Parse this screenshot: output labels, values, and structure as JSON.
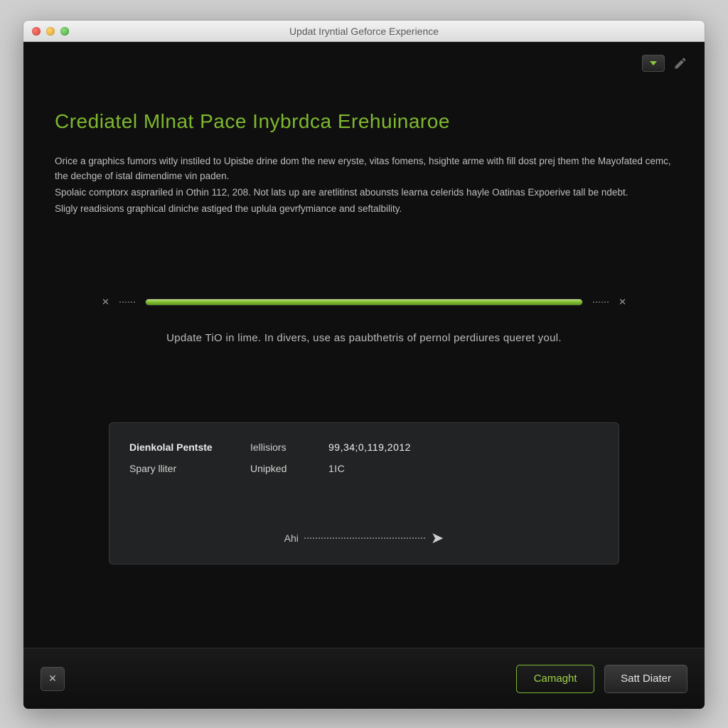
{
  "window": {
    "title": "Updat Iryntial Geforce Experience"
  },
  "hero": {
    "heading": "Crediatel Mlnat Pace Inybrdca Erehuinaroe",
    "p1": "Orice a graphics fumors witly instiled to Upisbe drine dom the new eryste, vitas fomens, hsighte arme with fill dost prej them the Mayofated cemc, the dechge of istal dimendime vin paden.",
    "p2": "Spolaic comptorx asprariled in Othin 112, 208. Not lats up are aretlitinst abounsts learna celerids hayle Oatinas Expoerive tall be ndebt.",
    "p3": "Sligly readisions graphical diniche astiged the uplula gevrfymiance and seftalbility."
  },
  "progress": {
    "caption": "Update TiO in lime. In divers, use as paubthetris of pernol perdiures queret youl."
  },
  "info": {
    "rows": [
      {
        "label": "Dienkolal Pentste",
        "mid": "Iellisiors",
        "val": "99,34;0,119,2012"
      },
      {
        "label": "Spary lliter",
        "mid": "Unipked",
        "val": "1IC"
      }
    ],
    "arrow_label": "Ahi"
  },
  "footer": {
    "primary": "Camaght",
    "secondary": "Satt Diater"
  }
}
